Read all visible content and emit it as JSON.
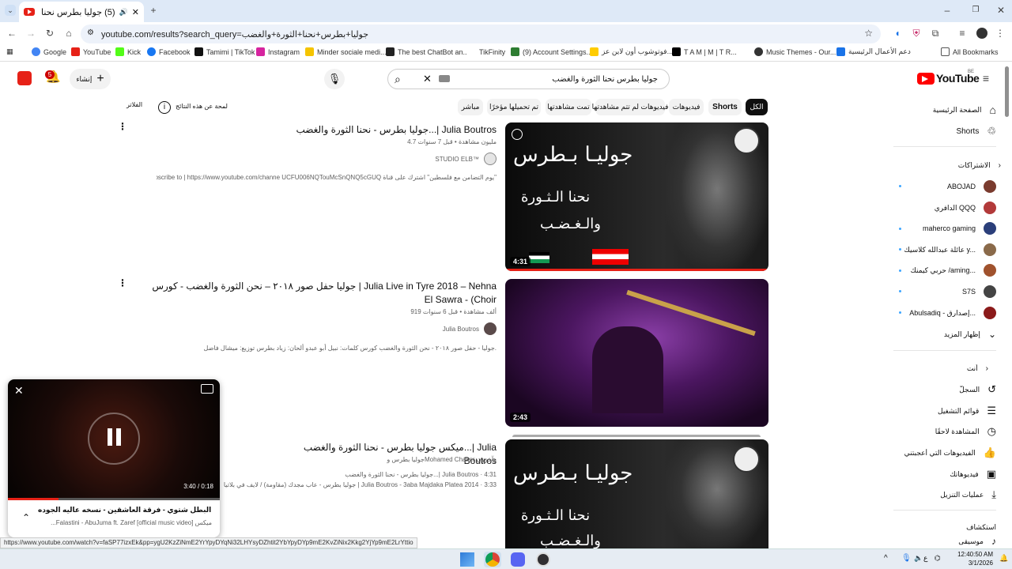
{
  "browser": {
    "tab_title": "(5) جوليا بطرس نحنا الثورة و...",
    "url": "youtube.com/results?search_query=جوليا+بطرس+نحنا+الثورة+والغضب",
    "bookmarks": [
      "Google",
      "YouTube",
      "Kick",
      "Facebook",
      "Tamimi | TikTok",
      "Instagram",
      "Minder sociale medi...",
      "The best ChatBot an...",
      "TikFinity",
      "(9) Account Settings...",
      "فوتوشوب أون لاين عز...",
      "T A M | M | T R...",
      "Music Themes - Our...",
      "دعم الأعمال الرئيسية",
      "All Bookmarks"
    ]
  },
  "youtube": {
    "logo_text": "YouTube",
    "logo_region": "BE",
    "search_value": "جوليا بطرس نحنا الثورة والغضب",
    "create_label": "إنشاء",
    "notif_count": "5",
    "filters_label": "الفلاتر",
    "about_results": "لمحة عن هذه النتائج",
    "chips": [
      "الكل",
      "Shorts",
      "فيديوهات",
      "فيديوهات لم تتم مشاهدتها",
      "تمت مشاهدتها",
      "تم تحميلها مؤخرًا",
      "مباشر"
    ]
  },
  "sidebar": {
    "home": "الصفحة الرئيسية",
    "shorts": "Shorts",
    "subs_header": "الاشتراكات",
    "subs": [
      {
        "name": "ABOJAD",
        "color": "#7a3b2e"
      },
      {
        "name": "الدافري QQQ",
        "color": "#b23a3a"
      },
      {
        "name": "maherco gaming",
        "color": "#2b3f7a"
      },
      {
        "name": "عائلة عبدالله كلاسيك y...",
        "color": "#8a6a4a"
      },
      {
        "name": "حربي كيمنك /aming...",
        "color": "#a0522d"
      },
      {
        "name": "S7S",
        "color": "#444"
      },
      {
        "name": "Abulsadiq - إصدارق...",
        "color": "#8b1a1a"
      }
    ],
    "show_more": "إظهار المزيد",
    "you_header": "أنت",
    "you_items": [
      "السجلّ",
      "قوائم التشغيل",
      "المشاهدة لاحقًا",
      "الفيديوهات التي أعجبتني",
      "فيديوهاتك",
      "عمليات التنزيل"
    ],
    "explore_header": "استكشاف",
    "explore_first": "موسيقى"
  },
  "results": [
    {
      "title": "جوليا بطرس - نحنا الثورة والغضب...| Julia Boutros",
      "meta": "4.7 مليون مشاهدة • قبل 7 سنوات",
      "channel": "STUDIO ELB™",
      "desc": "\"يوم التضامن مع فلسطين\" اشترك على قناة Subscribe to | https://www.youtube.com/channe UCFU006NQTouMcSnQNQ5cGUQ ...",
      "duration": "4:31",
      "thumb_line1": "جوليـا بـطرس",
      "thumb_line2": "نحنا الـثـورة",
      "thumb_line3": "والـغـضـب"
    },
    {
      "title": "جوليا حفل صور ٢٠١٨ – نحن الثورة والغضب - كورس | Julia Live in Tyre 2018 – Nehna El Sawra - (Choir",
      "meta": "919 ألف مشاهدة • قبل 6 سنوات",
      "channel": "Julia Boutros",
      "desc": "جوليا - حفل صور ٢٠١٨ - نحن الثورة والغضب كورس كلمات: نبيل أبو عبدو ألحان: زياد بطرس توزيع: ميشال فاضل.",
      "duration": "2:43"
    },
    {
      "title": "ميكس جوليا بطرس - نحنا الثورة والغضب...| Julia Boutros",
      "meta": "جوليا بطرس وMohamed Chaker وآخرون",
      "track1": "جوليا بطرس - نحنا الثورة والغضب...| Julia Boutros · 4:31",
      "track2": "جوليا بطرس - عاب مجدك (مقاومة) / لايف في بلاتيا | Julia Boutros - 3aba Majdaka Platea 2014 · 3:33",
      "thumb_line1": "جوليـا بـطرس",
      "thumb_line2": "نحنا الـثـورة",
      "thumb_line3": "والـغـضـب"
    }
  ],
  "miniplayer": {
    "time": "3:40 / 0:18",
    "title": "شتوي البطل شتوي - فرقة العاشقين - نسخه عاليه الجوده mp3",
    "next": "ميكس Falastini - AbuJuma ft. Zaref [official music video]...",
    "progress": 0.24
  },
  "status_url": "https://www.youtube.com/watch?v=faSP77izxEk&pp=ygU2KzZiNmE2YrYpyDYqNi32LHYsyDZhtit2YbYpyDYp9mE2KvZiNix2Kkg2YjYp9mE2LrYttio",
  "taskbar": {
    "time": "12:40:50 AM",
    "date": "3/1/2026",
    "lang": "ع"
  }
}
